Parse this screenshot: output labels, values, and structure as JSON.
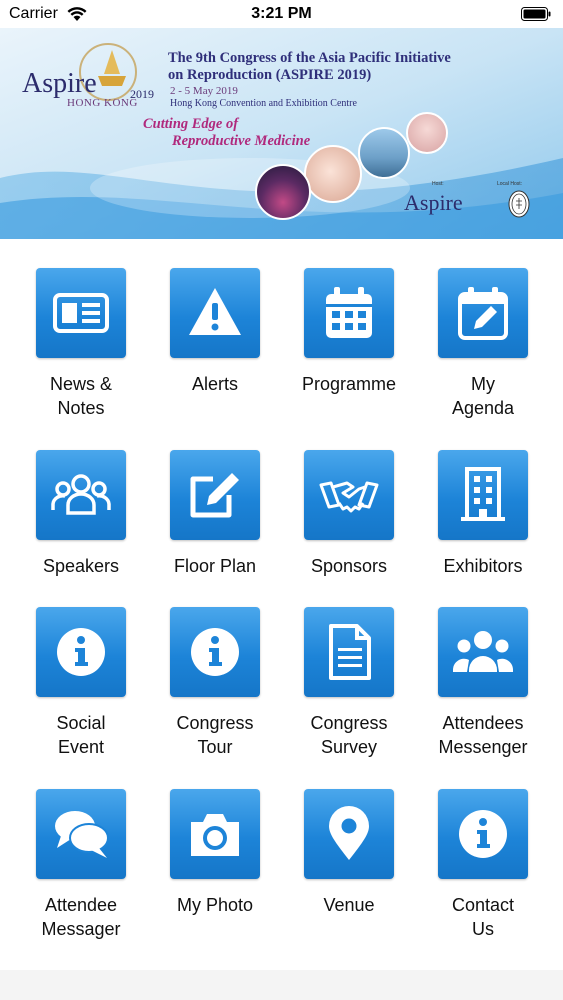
{
  "status_bar": {
    "carrier": "Carrier",
    "time": "3:21 PM"
  },
  "banner": {
    "logo_text": "Aspire",
    "logo_city": "HONG KONG",
    "logo_year": "2019",
    "title_line1": "The 9th Congress of the Asia Pacific Initiative",
    "title_line2": "on Reproduction (ASPIRE 2019)",
    "date": "2 - 5 May 2019",
    "venue": "Hong Kong Convention and Exhibition Centre",
    "tagline_line1": "Cutting Edge of",
    "tagline_line2": "Reproductive Medicine",
    "host_label": "Host:",
    "host_logo": "Aspire",
    "local_host_label": "Local Host:"
  },
  "menu": [
    {
      "label": "News &\nNotes",
      "icon": "newspaper-icon"
    },
    {
      "label": "Alerts",
      "icon": "warning-icon"
    },
    {
      "label": "Programme",
      "icon": "calendar-icon"
    },
    {
      "label": "My\nAgenda",
      "icon": "calendar-edit-icon"
    },
    {
      "label": "Speakers",
      "icon": "group-icon"
    },
    {
      "label": "Floor Plan",
      "icon": "edit-icon"
    },
    {
      "label": "Sponsors",
      "icon": "handshake-icon"
    },
    {
      "label": "Exhibitors",
      "icon": "building-icon"
    },
    {
      "label": "Social\nEvent",
      "icon": "info-icon"
    },
    {
      "label": "Congress\nTour",
      "icon": "info-icon"
    },
    {
      "label": "Congress\nSurvey",
      "icon": "document-icon"
    },
    {
      "label": "Attendees\nMessenger",
      "icon": "users-icon"
    },
    {
      "label": "Attendee\nMessager",
      "icon": "chat-icon"
    },
    {
      "label": "My Photo",
      "icon": "camera-icon"
    },
    {
      "label": "Venue",
      "icon": "map-pin-icon"
    },
    {
      "label": "Contact\nUs",
      "icon": "info-icon"
    }
  ]
}
